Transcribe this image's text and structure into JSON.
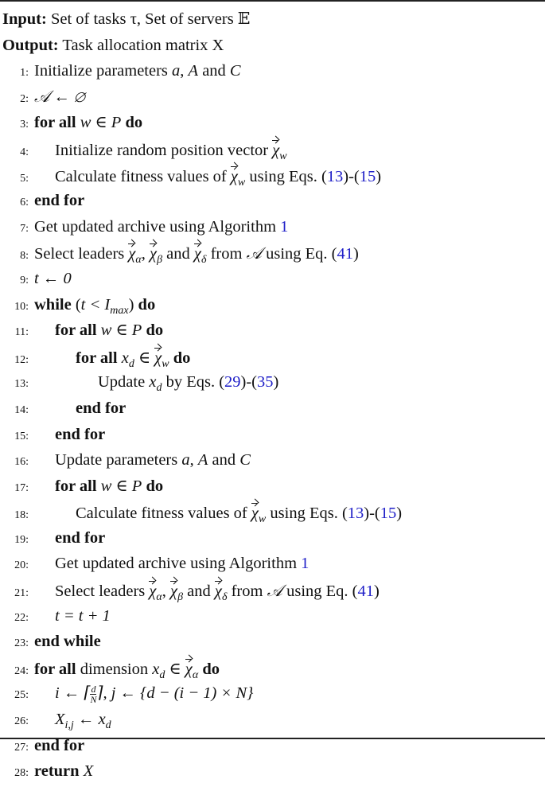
{
  "header": {
    "input_label": "Input:",
    "input_text": "Set of tasks τ, Set of servers 𝔼",
    "output_label": "Output:",
    "output_text": "Task allocation matrix X"
  },
  "link_color": "#2020c8",
  "lines": [
    {
      "n": "1:",
      "indent": 0,
      "parts": [
        {
          "t": "Initialize parameters "
        },
        {
          "m": "a"
        },
        {
          "t": ", "
        },
        {
          "m": "A"
        },
        {
          "t": " and "
        },
        {
          "m": "C"
        }
      ]
    },
    {
      "n": "2:",
      "indent": 0,
      "parts": [
        {
          "m": "𝒜 ← ∅"
        }
      ]
    },
    {
      "n": "3:",
      "indent": 0,
      "parts": [
        {
          "k": "for all "
        },
        {
          "m": "w ∈ P"
        },
        {
          "k": " do"
        }
      ]
    },
    {
      "n": "4:",
      "indent": 1,
      "parts": [
        {
          "t": "Initialize random position vector "
        },
        {
          "v": "χ",
          "s": "w"
        }
      ]
    },
    {
      "n": "5:",
      "indent": 1,
      "parts": [
        {
          "t": "Calculate fitness values of "
        },
        {
          "v": "χ",
          "s": "w"
        },
        {
          "t": " using Eqs. ("
        },
        {
          "r": "13"
        },
        {
          "t": ")-("
        },
        {
          "r": "15"
        },
        {
          "t": ")"
        }
      ]
    },
    {
      "n": "6:",
      "indent": 0,
      "parts": [
        {
          "k": "end for"
        }
      ]
    },
    {
      "n": "7:",
      "indent": 0,
      "parts": [
        {
          "t": "Get updated archive using Algorithm "
        },
        {
          "r": "1"
        }
      ]
    },
    {
      "n": "8:",
      "indent": 0,
      "parts": [
        {
          "t": "Select leaders "
        },
        {
          "v": "χ",
          "s": "α"
        },
        {
          "t": ", "
        },
        {
          "v": "χ",
          "s": "β"
        },
        {
          "t": " and "
        },
        {
          "v": "χ",
          "s": "δ"
        },
        {
          "t": " from "
        },
        {
          "m": "𝒜"
        },
        {
          "t": " using Eq. ("
        },
        {
          "r": "41"
        },
        {
          "t": ")"
        }
      ]
    },
    {
      "n": "9:",
      "indent": 0,
      "parts": [
        {
          "m": "t ← 0"
        }
      ]
    },
    {
      "n": "10:",
      "indent": 0,
      "parts": [
        {
          "k": "while "
        },
        {
          "t": "("
        },
        {
          "m": "t < I"
        },
        {
          "s": "max"
        },
        {
          "t": ")"
        },
        {
          "k": " do"
        }
      ]
    },
    {
      "n": "11:",
      "indent": 1,
      "parts": [
        {
          "k": "for all "
        },
        {
          "m": "w ∈ P"
        },
        {
          "k": " do"
        }
      ]
    },
    {
      "n": "12:",
      "indent": 2,
      "parts": [
        {
          "k": "for all "
        },
        {
          "m": "x"
        },
        {
          "s": "d"
        },
        {
          "m": " ∈ "
        },
        {
          "v": "χ",
          "s": "w"
        },
        {
          "k": " do"
        }
      ]
    },
    {
      "n": "13:",
      "indent": 3,
      "parts": [
        {
          "t": "Update "
        },
        {
          "m": "x"
        },
        {
          "s": "d"
        },
        {
          "t": " by Eqs. ("
        },
        {
          "r": "29"
        },
        {
          "t": ")-("
        },
        {
          "r": "35"
        },
        {
          "t": ")"
        }
      ]
    },
    {
      "n": "14:",
      "indent": 2,
      "parts": [
        {
          "k": "end for"
        }
      ]
    },
    {
      "n": "15:",
      "indent": 1,
      "parts": [
        {
          "k": "end for"
        }
      ]
    },
    {
      "n": "16:",
      "indent": 1,
      "parts": [
        {
          "t": "Update parameters "
        },
        {
          "m": "a"
        },
        {
          "t": ", "
        },
        {
          "m": "A"
        },
        {
          "t": " and "
        },
        {
          "m": "C"
        }
      ]
    },
    {
      "n": "17:",
      "indent": 1,
      "parts": [
        {
          "k": "for all "
        },
        {
          "m": "w ∈ P"
        },
        {
          "k": " do"
        }
      ]
    },
    {
      "n": "18:",
      "indent": 2,
      "parts": [
        {
          "t": "Calculate fitness values of "
        },
        {
          "v": "χ",
          "s": "w"
        },
        {
          "t": " using Eqs. ("
        },
        {
          "r": "13"
        },
        {
          "t": ")-("
        },
        {
          "r": "15"
        },
        {
          "t": ")"
        }
      ]
    },
    {
      "n": "19:",
      "indent": 1,
      "parts": [
        {
          "k": "end for"
        }
      ]
    },
    {
      "n": "20:",
      "indent": 1,
      "parts": [
        {
          "t": "Get updated archive using Algorithm "
        },
        {
          "r": "1"
        }
      ]
    },
    {
      "n": "21:",
      "indent": 1,
      "parts": [
        {
          "t": "Select leaders "
        },
        {
          "v": "χ",
          "s": "α"
        },
        {
          "t": ", "
        },
        {
          "v": "χ",
          "s": "β"
        },
        {
          "t": " and "
        },
        {
          "v": "χ",
          "s": "δ"
        },
        {
          "t": " from "
        },
        {
          "m": "𝒜"
        },
        {
          "t": " using Eq. ("
        },
        {
          "r": "41"
        },
        {
          "t": ")"
        }
      ]
    },
    {
      "n": "22:",
      "indent": 1,
      "parts": [
        {
          "m": "t = t + 1"
        }
      ]
    },
    {
      "n": "23:",
      "indent": 0,
      "parts": [
        {
          "k": "end while"
        }
      ]
    },
    {
      "n": "24:",
      "indent": 0,
      "parts": [
        {
          "k": "for all "
        },
        {
          "t": "dimension "
        },
        {
          "m": "x"
        },
        {
          "s": "d"
        },
        {
          "m": " ∈ "
        },
        {
          "v": "χ",
          "s": "α"
        },
        {
          "k": " do"
        }
      ]
    },
    {
      "n": "25:",
      "indent": 1,
      "parts": [
        {
          "m": "i ← ⌈"
        },
        {
          "f": [
            "d",
            "N"
          ]
        },
        {
          "m": "⌉, j ← {d − (i − 1) × N}"
        }
      ]
    },
    {
      "n": "26:",
      "indent": 1,
      "parts": [
        {
          "m": "X"
        },
        {
          "s": "i,j"
        },
        {
          "m": " ← x"
        },
        {
          "s": "d"
        }
      ]
    },
    {
      "n": "27:",
      "indent": 0,
      "parts": [
        {
          "k": "end for"
        }
      ]
    },
    {
      "n": "28:",
      "indent": 0,
      "parts": [
        {
          "k": "return "
        },
        {
          "m": "  X"
        }
      ]
    }
  ]
}
